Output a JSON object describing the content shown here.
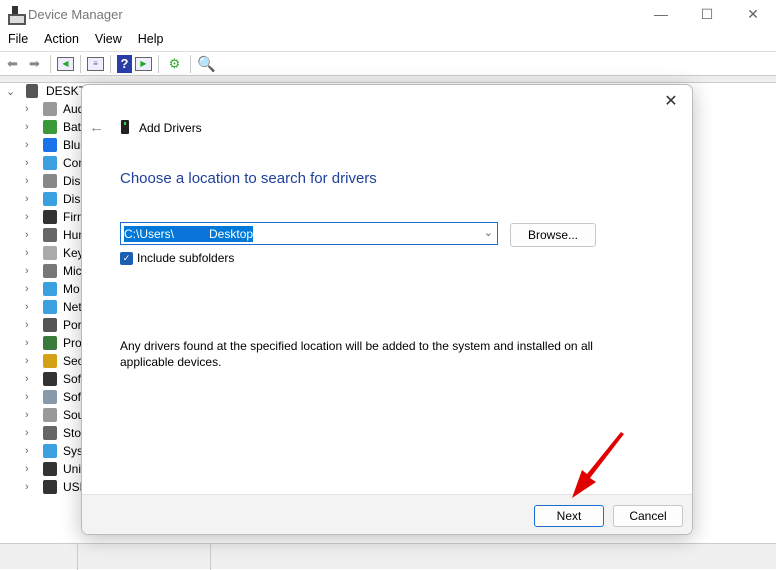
{
  "window": {
    "title": "Device Manager",
    "controls": [
      "minimize",
      "maximize",
      "close"
    ]
  },
  "menu": [
    "File",
    "Action",
    "View",
    "Help"
  ],
  "toolbar": [
    "back-icon",
    "forward-icon",
    "show-hide-console-tree-icon",
    "properties-icon",
    "help-icon",
    "action-pane-icon",
    "update-driver-icon",
    "scan-hardware-icon"
  ],
  "tree": {
    "root": "DESKTO",
    "items": [
      {
        "label": "Aud",
        "icon": "speaker-icon",
        "color": "#999999"
      },
      {
        "label": "Batt",
        "icon": "battery-icon",
        "color": "#3a9a3a"
      },
      {
        "label": "Blue",
        "icon": "bluetooth-icon",
        "color": "#1a73e8"
      },
      {
        "label": "Com",
        "icon": "monitor-icon",
        "color": "#3aa0e0"
      },
      {
        "label": "Disk",
        "icon": "disk-icon",
        "color": "#888888"
      },
      {
        "label": "Disp",
        "icon": "display-adapter-icon",
        "color": "#3aa0e0"
      },
      {
        "label": "Firm",
        "icon": "chip-icon",
        "color": "#333333"
      },
      {
        "label": "Hum",
        "icon": "gamepad-icon",
        "color": "#666666"
      },
      {
        "label": "Key",
        "icon": "keyboard-icon",
        "color": "#aaaaaa"
      },
      {
        "label": "Mic",
        "icon": "mouse-icon",
        "color": "#777777"
      },
      {
        "label": "Mo",
        "icon": "monitor-icon",
        "color": "#3aa0e0"
      },
      {
        "label": "Net",
        "icon": "network-icon",
        "color": "#3aa0e0"
      },
      {
        "label": "Port",
        "icon": "port-icon",
        "color": "#555555"
      },
      {
        "label": "Pro",
        "icon": "processor-icon",
        "color": "#3a7a3a"
      },
      {
        "label": "Sec",
        "icon": "security-key-icon",
        "color": "#d4a017"
      },
      {
        "label": "Soft",
        "icon": "software-component-icon",
        "color": "#333333"
      },
      {
        "label": "Soft",
        "icon": "software-device-icon",
        "color": "#8899aa"
      },
      {
        "label": "Sou",
        "icon": "speaker-icon",
        "color": "#999999"
      },
      {
        "label": "Stor",
        "icon": "storage-controller-icon",
        "color": "#666666"
      },
      {
        "label": "Syst",
        "icon": "system-devices-icon",
        "color": "#3aa0e0"
      },
      {
        "label": "Univ",
        "icon": "usb-icon",
        "color": "#333333"
      },
      {
        "label": "USB",
        "icon": "usb-icon",
        "color": "#333333"
      }
    ]
  },
  "dialog": {
    "title": "Add Drivers",
    "heading": "Choose a location to search for drivers",
    "path_prefix": "C:\\Users\\",
    "path_suffix": "Desktop",
    "browse_label": "Browse...",
    "include_subfolders_label": "Include subfolders",
    "include_subfolders_checked": true,
    "note": "Any drivers found at the specified location will be added to the system and installed on all applicable devices.",
    "next_label": "Next",
    "cancel_label": "Cancel",
    "accent": "#1e3f9e",
    "annotation_arrow_color": "#e00000"
  }
}
